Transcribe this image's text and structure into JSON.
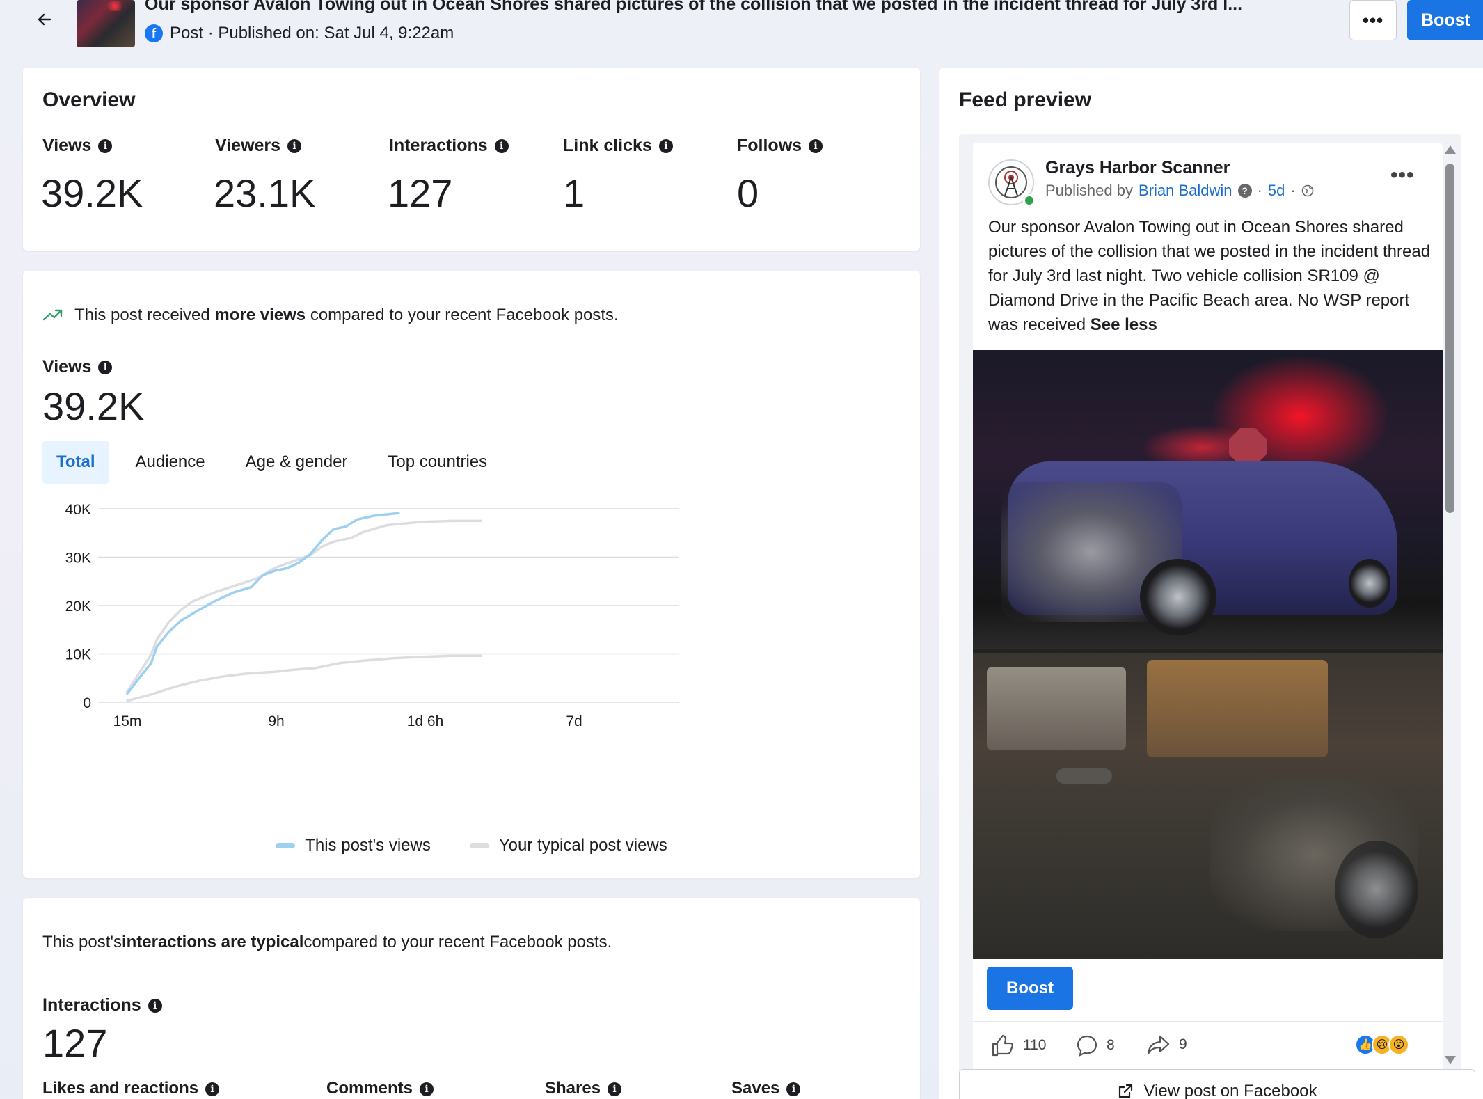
{
  "header": {
    "title": "Our sponsor Avalon Towing out in Ocean Shores shared pictures of the collision that we posted in the incident thread for July 3rd l...",
    "meta": "Post · Published on: Sat Jul 4, 9:22am",
    "more_label": "•••",
    "boost_label": "Boost"
  },
  "overview": {
    "title": "Overview",
    "metrics": [
      {
        "label": "Views",
        "value": "39.2K"
      },
      {
        "label": "Viewers",
        "value": "23.1K"
      },
      {
        "label": "Interactions",
        "value": "127"
      },
      {
        "label": "Link clicks",
        "value": "1"
      },
      {
        "label": "Follows",
        "value": "0"
      }
    ]
  },
  "views_section": {
    "insight_prefix": "This post received ",
    "insight_bold": "more views",
    "insight_suffix": " compared to your recent Facebook posts.",
    "label": "Views",
    "value": "39.2K",
    "tabs": [
      "Total",
      "Audience",
      "Age & gender",
      "Top countries"
    ],
    "active_tab": "Total"
  },
  "chart_data": {
    "type": "line",
    "x_ticks": [
      "15m",
      "9h",
      "1d 6h",
      "7d"
    ],
    "y_ticks": [
      "0",
      "10K",
      "20K",
      "30K",
      "40K"
    ],
    "ylim": [
      0,
      40000
    ],
    "grid": true,
    "legend_position": "bottom",
    "series": [
      {
        "name": "This post's views",
        "color": "#9dd0f0",
        "points": [
          [
            0,
            1800
          ],
          [
            0.04,
            5000
          ],
          [
            0.08,
            8000
          ],
          [
            0.1,
            11500
          ],
          [
            0.14,
            14500
          ],
          [
            0.18,
            16800
          ],
          [
            0.24,
            19000
          ],
          [
            0.3,
            21000
          ],
          [
            0.36,
            22700
          ],
          [
            0.42,
            23800
          ],
          [
            0.46,
            26300
          ],
          [
            0.5,
            27200
          ],
          [
            0.54,
            27700
          ],
          [
            0.58,
            28800
          ],
          [
            0.62,
            30600
          ],
          [
            0.66,
            33500
          ],
          [
            0.7,
            35800
          ],
          [
            0.74,
            36300
          ],
          [
            0.78,
            37800
          ],
          [
            0.84,
            38600
          ],
          [
            0.92,
            39100
          ]
        ]
      },
      {
        "name": "Your typical post views",
        "color": "#dcdde0",
        "points": [
          [
            0,
            2200
          ],
          [
            0.04,
            6000
          ],
          [
            0.08,
            9800
          ],
          [
            0.1,
            13000
          ],
          [
            0.14,
            16500
          ],
          [
            0.18,
            19000
          ],
          [
            0.22,
            20800
          ],
          [
            0.3,
            22800
          ],
          [
            0.38,
            24400
          ],
          [
            0.44,
            25600
          ],
          [
            0.5,
            27800
          ],
          [
            0.56,
            29100
          ],
          [
            0.62,
            30400
          ],
          [
            0.66,
            32200
          ],
          [
            0.7,
            33200
          ],
          [
            0.76,
            34000
          ],
          [
            0.8,
            35200
          ],
          [
            0.88,
            36600
          ],
          [
            1.0,
            37300
          ],
          [
            1.1,
            37500
          ],
          [
            1.2,
            37500
          ]
        ]
      },
      {
        "name": "Your typical post views (lower)",
        "color": "#dcdde0",
        "points": [
          [
            0,
            300
          ],
          [
            0.08,
            1600
          ],
          [
            0.16,
            3200
          ],
          [
            0.24,
            4400
          ],
          [
            0.32,
            5300
          ],
          [
            0.4,
            5900
          ],
          [
            0.5,
            6300
          ],
          [
            0.56,
            6700
          ],
          [
            0.64,
            7100
          ],
          [
            0.72,
            8100
          ],
          [
            0.8,
            8600
          ],
          [
            0.9,
            9100
          ],
          [
            1.0,
            9400
          ],
          [
            1.1,
            9600
          ],
          [
            1.2,
            9600
          ]
        ]
      }
    ]
  },
  "interactions_section": {
    "insight_prefix": "This post's ",
    "insight_bold": "interactions are typical",
    "insight_suffix": " compared to your recent Facebook posts.",
    "label": "Interactions",
    "value": "127",
    "sub_metrics": [
      "Likes and reactions",
      "Comments",
      "Shares",
      "Saves"
    ]
  },
  "feed_preview": {
    "title": "Feed preview",
    "page_name": "Grays Harbor Scanner",
    "published_by_prefix": "Published by",
    "publisher": "Brian Baldwin",
    "age": "5d",
    "text_body": "Our sponsor Avalon Towing out in Ocean Shores shared pictures of the collision that we posted in the incident thread for July 3rd last night. Two vehicle collision SR109 @ Diamond Drive in the Pacific Beach area. No WSP report was received",
    "see_less": "See less",
    "boost_label": "Boost",
    "likes": "110",
    "comments": "8",
    "shares": "9",
    "view_on_facebook": "View post on Facebook"
  }
}
